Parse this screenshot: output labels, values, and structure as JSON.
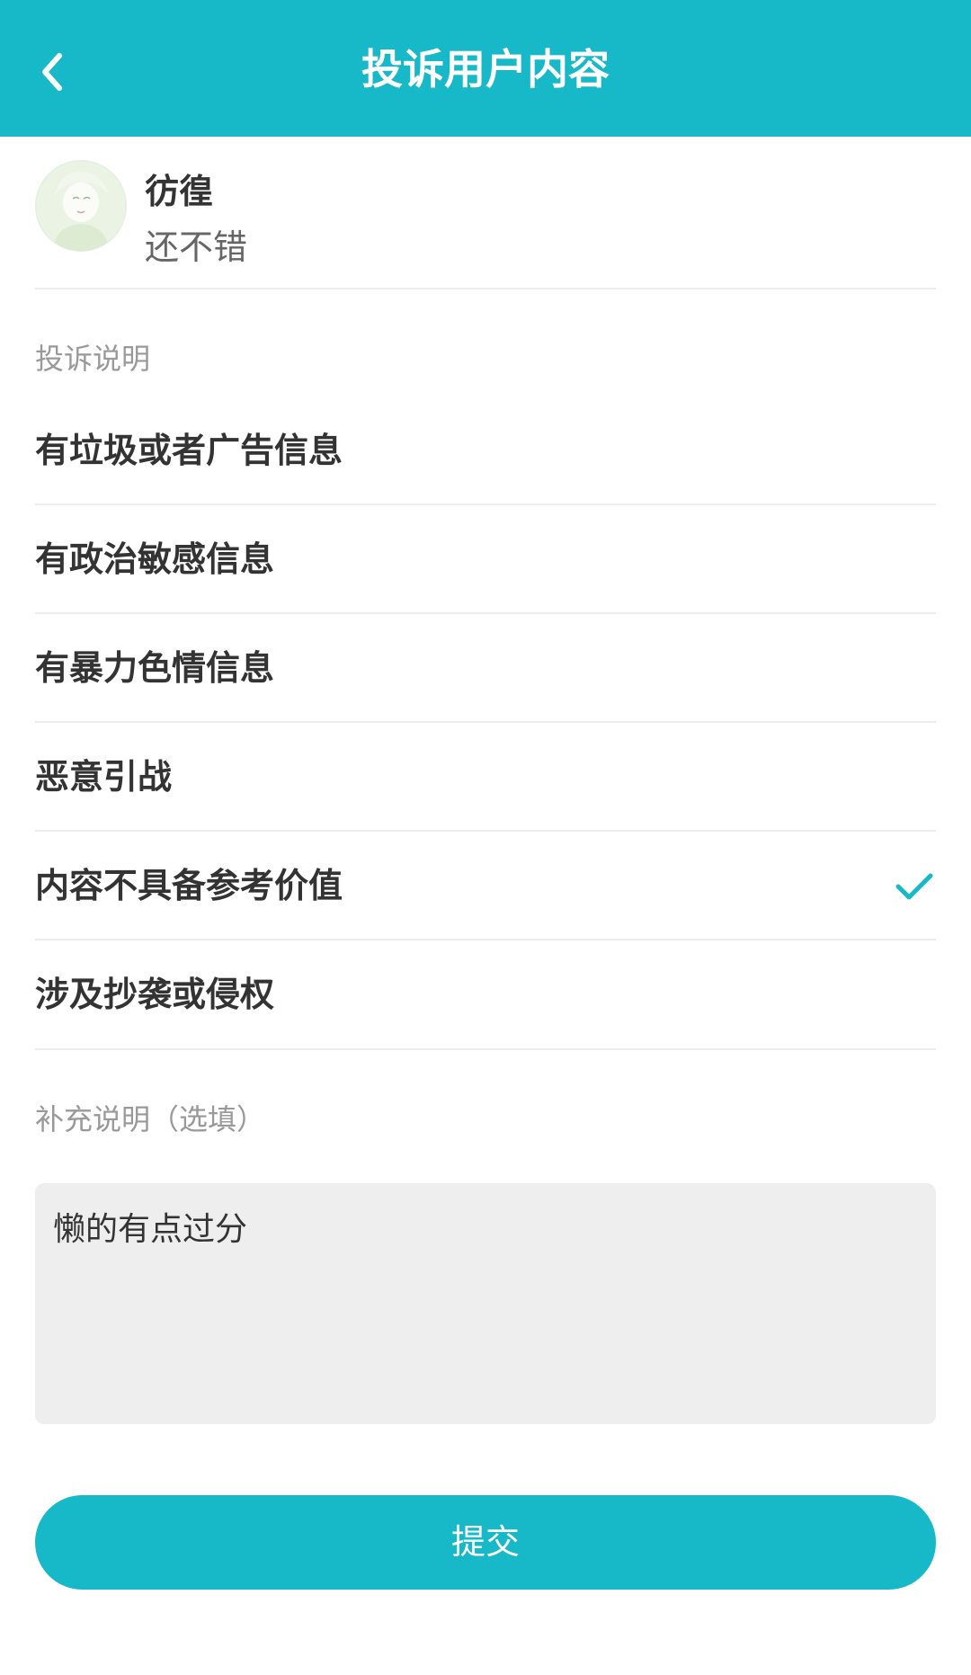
{
  "header": {
    "title": "投诉用户内容",
    "back_icon": "chevron-left-icon",
    "background": "#17b8c7"
  },
  "user": {
    "name": "彷徨",
    "comment": "还不错"
  },
  "complaint_section": {
    "label": "投诉说明",
    "options": [
      {
        "label": "有垃圾或者广告信息",
        "selected": false
      },
      {
        "label": "有政治敏感信息",
        "selected": false
      },
      {
        "label": "有暴力色情信息",
        "selected": false
      },
      {
        "label": "恶意引战",
        "selected": false
      },
      {
        "label": "内容不具备参考价值",
        "selected": true
      },
      {
        "label": "涉及抄袭或侵权",
        "selected": false
      }
    ],
    "check_icon": "checkmark-icon",
    "accent": "#17b8c7"
  },
  "note_section": {
    "label": "补充说明（选填）",
    "value": "懒的有点过分"
  },
  "submit": {
    "label": "提交"
  }
}
